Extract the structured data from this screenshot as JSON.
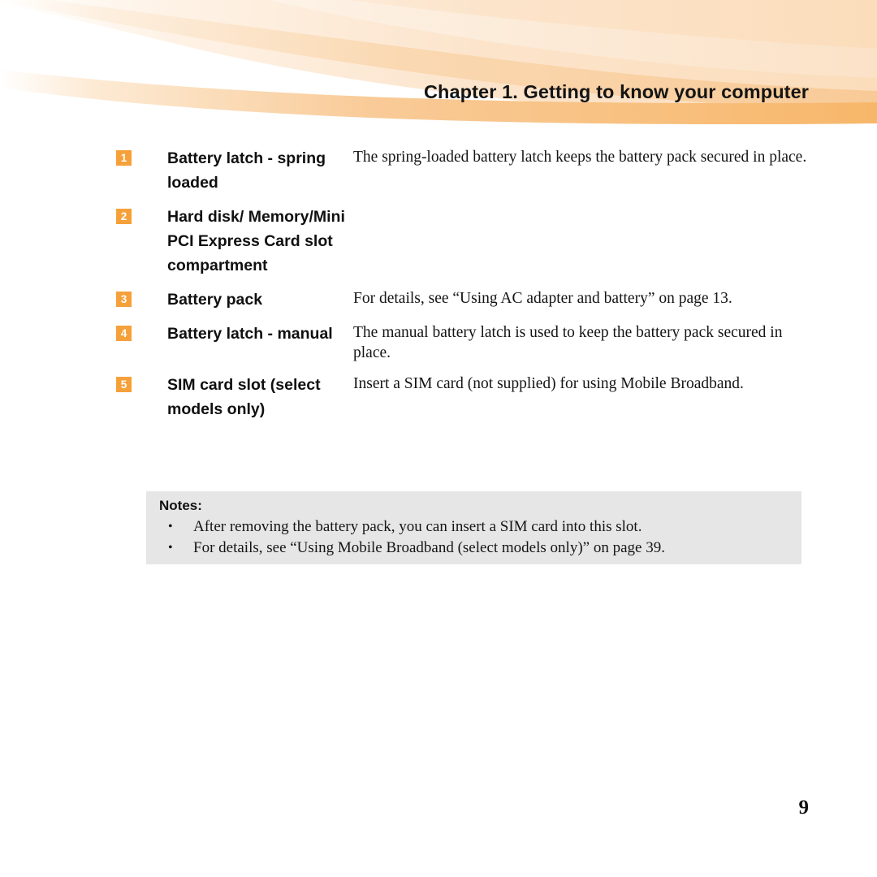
{
  "header": {
    "title": "Chapter 1. Getting to know your computer",
    "accent_color": "#F6A03A",
    "band_light": "#FBDDBB",
    "band_mid": "#F9C68E",
    "band_strong": "#F7B76A"
  },
  "features": [
    {
      "number": "1",
      "label": "Battery latch - spring loaded",
      "description": "The spring-loaded battery latch keeps the battery pack secured in place."
    },
    {
      "number": "2",
      "label": "Hard disk/ Memory/Mini PCI Express Card slot compartment",
      "description": ""
    },
    {
      "number": "3",
      "label": "Battery pack",
      "description": "For details, see “Using AC adapter and battery” on page 13."
    },
    {
      "number": "4",
      "label": "Battery latch - manual",
      "description": "The manual battery latch is used to keep the battery pack secured in place."
    },
    {
      "number": "5",
      "label": "SIM card slot (select models only)",
      "description": "Insert a SIM card (not supplied) for using Mobile Broadband."
    }
  ],
  "notes": {
    "heading": "Notes:",
    "bullet_glyph": "•",
    "background_color": "#E6E6E6",
    "items": [
      "After removing the battery pack, you can insert a SIM card into this slot.",
      "For details, see “Using Mobile Broadband (select models only)” on page 39."
    ]
  },
  "footer": {
    "page_number": "9"
  }
}
